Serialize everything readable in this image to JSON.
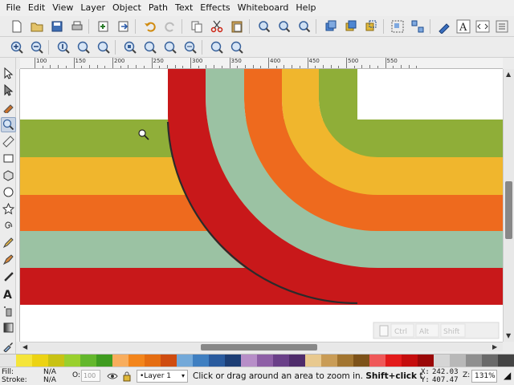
{
  "menubar": {
    "items": [
      {
        "label": "File"
      },
      {
        "label": "Edit"
      },
      {
        "label": "View"
      },
      {
        "label": "Layer"
      },
      {
        "label": "Object"
      },
      {
        "label": "Path"
      },
      {
        "label": "Text"
      },
      {
        "label": "Effects"
      },
      {
        "label": "Whiteboard"
      },
      {
        "label": "Help"
      }
    ]
  },
  "ruler": {
    "labels": [
      "100",
      "150",
      "200",
      "250",
      "300",
      "350",
      "400",
      "450",
      "500",
      "550"
    ]
  },
  "canvas": {
    "hover_overlay": {
      "items": [
        "Ctrl",
        "Alt",
        "Shift"
      ]
    }
  },
  "palette": {
    "swatches": [
      "#e5e5e5",
      "#f5e53a",
      "#ecd314",
      "#c8c214",
      "#99d02e",
      "#63b72c",
      "#3f9c20",
      "#f8ad5d",
      "#f3851b",
      "#e56d11",
      "#cf4c10",
      "#73a9d9",
      "#3f7fc1",
      "#2a5b9e",
      "#1d3e75",
      "#b78ec8",
      "#8e5fa6",
      "#6a3f88",
      "#4f2c6b",
      "#e8c98f",
      "#c99c56",
      "#a27530",
      "#7d5219",
      "#ef5858",
      "#e31a1a",
      "#c50d0d",
      "#9a0808",
      "#d5d5d5",
      "#b8b8b8",
      "#8f8f8f",
      "#6a6a6a",
      "#444444"
    ]
  },
  "statusbar": {
    "fill_label": "Fill:",
    "fill_value": "N/A",
    "stroke_label": "Stroke:",
    "stroke_value": "N/A",
    "opacity_label": "O:",
    "opacity_value": "100",
    "layer": "•Layer 1",
    "message_prefix": "Click or drag around an area to zoom in.",
    "message_bold": "Shift+click",
    "message_suffix": " t",
    "x_label": "X:",
    "x_value": "242.03",
    "y_label": "Y:",
    "y_value": "407.47",
    "z_label": "Z:",
    "zoom_value": "131%"
  },
  "colors": {
    "red": "#c8181a",
    "sage": "#9bc2a3",
    "orange": "#ee6a1e",
    "yellow": "#f0b62d",
    "green": "#8fae38",
    "stroke": "#2b2b2b"
  }
}
